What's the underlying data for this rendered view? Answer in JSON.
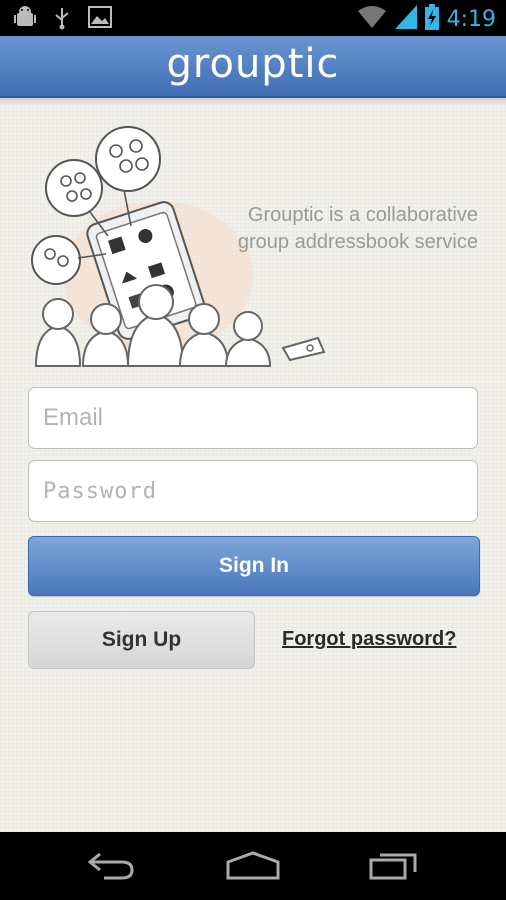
{
  "status_bar": {
    "time": "4:19",
    "left_icons": [
      "android-debug-icon",
      "usb-icon",
      "image-icon"
    ],
    "right_icons": [
      "wifi-icon",
      "signal-icon",
      "battery-charging-icon"
    ],
    "accent_color": "#33b5e5"
  },
  "app_bar": {
    "title": "grouptic",
    "color": "#4a7bbf"
  },
  "intro": {
    "tagline": "Grouptic is a collaborative group addressbook service"
  },
  "form": {
    "email_placeholder": "Email",
    "email_value": "",
    "password_placeholder": "Password",
    "password_value": "",
    "sign_in_label": "Sign In",
    "sign_up_label": "Sign Up",
    "forgot_label": "Forgot password?"
  },
  "nav_bar": {
    "buttons": [
      "back-icon",
      "home-icon",
      "recent-apps-icon"
    ]
  }
}
